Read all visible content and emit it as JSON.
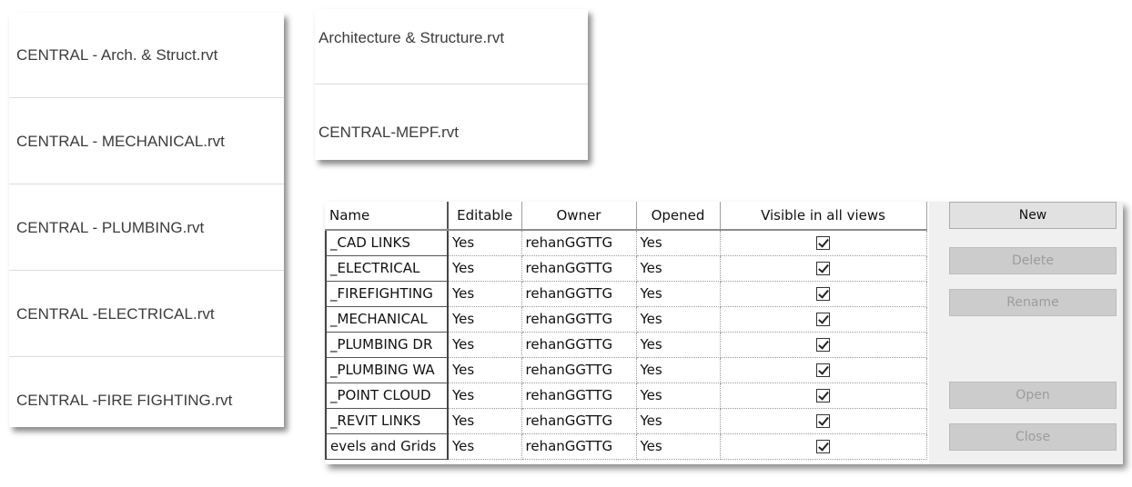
{
  "left_files": [
    "CENTRAL - Arch. & Struct.rvt",
    "CENTRAL - MECHANICAL.rvt",
    "CENTRAL - PLUMBING.rvt",
    "CENTRAL -ELECTRICAL.rvt",
    "CENTRAL -FIRE FIGHTING.rvt"
  ],
  "right_files": [
    "Architecture & Structure.rvt",
    "CENTRAL-MEPF.rvt"
  ],
  "worksets": {
    "columns": [
      "Name",
      "Editable",
      "Owner",
      "Opened",
      "Visible in all views"
    ],
    "rows": [
      {
        "name": "_CAD LINKS",
        "editable": "Yes",
        "owner": "rehanGGTTG",
        "opened": "Yes",
        "visible": true
      },
      {
        "name": "_ELECTRICAL",
        "editable": "Yes",
        "owner": "rehanGGTTG",
        "opened": "Yes",
        "visible": true
      },
      {
        "name": "_FIREFIGHTING",
        "editable": "Yes",
        "owner": "rehanGGTTG",
        "opened": "Yes",
        "visible": true
      },
      {
        "name": "_MECHANICAL",
        "editable": "Yes",
        "owner": "rehanGGTTG",
        "opened": "Yes",
        "visible": true
      },
      {
        "name": "_PLUMBING DR",
        "editable": "Yes",
        "owner": "rehanGGTTG",
        "opened": "Yes",
        "visible": true
      },
      {
        "name": "_PLUMBING WA",
        "editable": "Yes",
        "owner": "rehanGGTTG",
        "opened": "Yes",
        "visible": true
      },
      {
        "name": "_POINT CLOUD",
        "editable": "Yes",
        "owner": "rehanGGTTG",
        "opened": "Yes",
        "visible": true
      },
      {
        "name": "_REVIT LINKS",
        "editable": "Yes",
        "owner": "rehanGGTTG",
        "opened": "Yes",
        "visible": true
      },
      {
        "name": "evels and Grids",
        "editable": "Yes",
        "owner": "rehanGGTTG",
        "opened": "Yes",
        "visible": true
      }
    ]
  },
  "buttons": {
    "new": "New",
    "delete": "Delete",
    "rename": "Rename",
    "open": "Open",
    "close": "Close"
  }
}
